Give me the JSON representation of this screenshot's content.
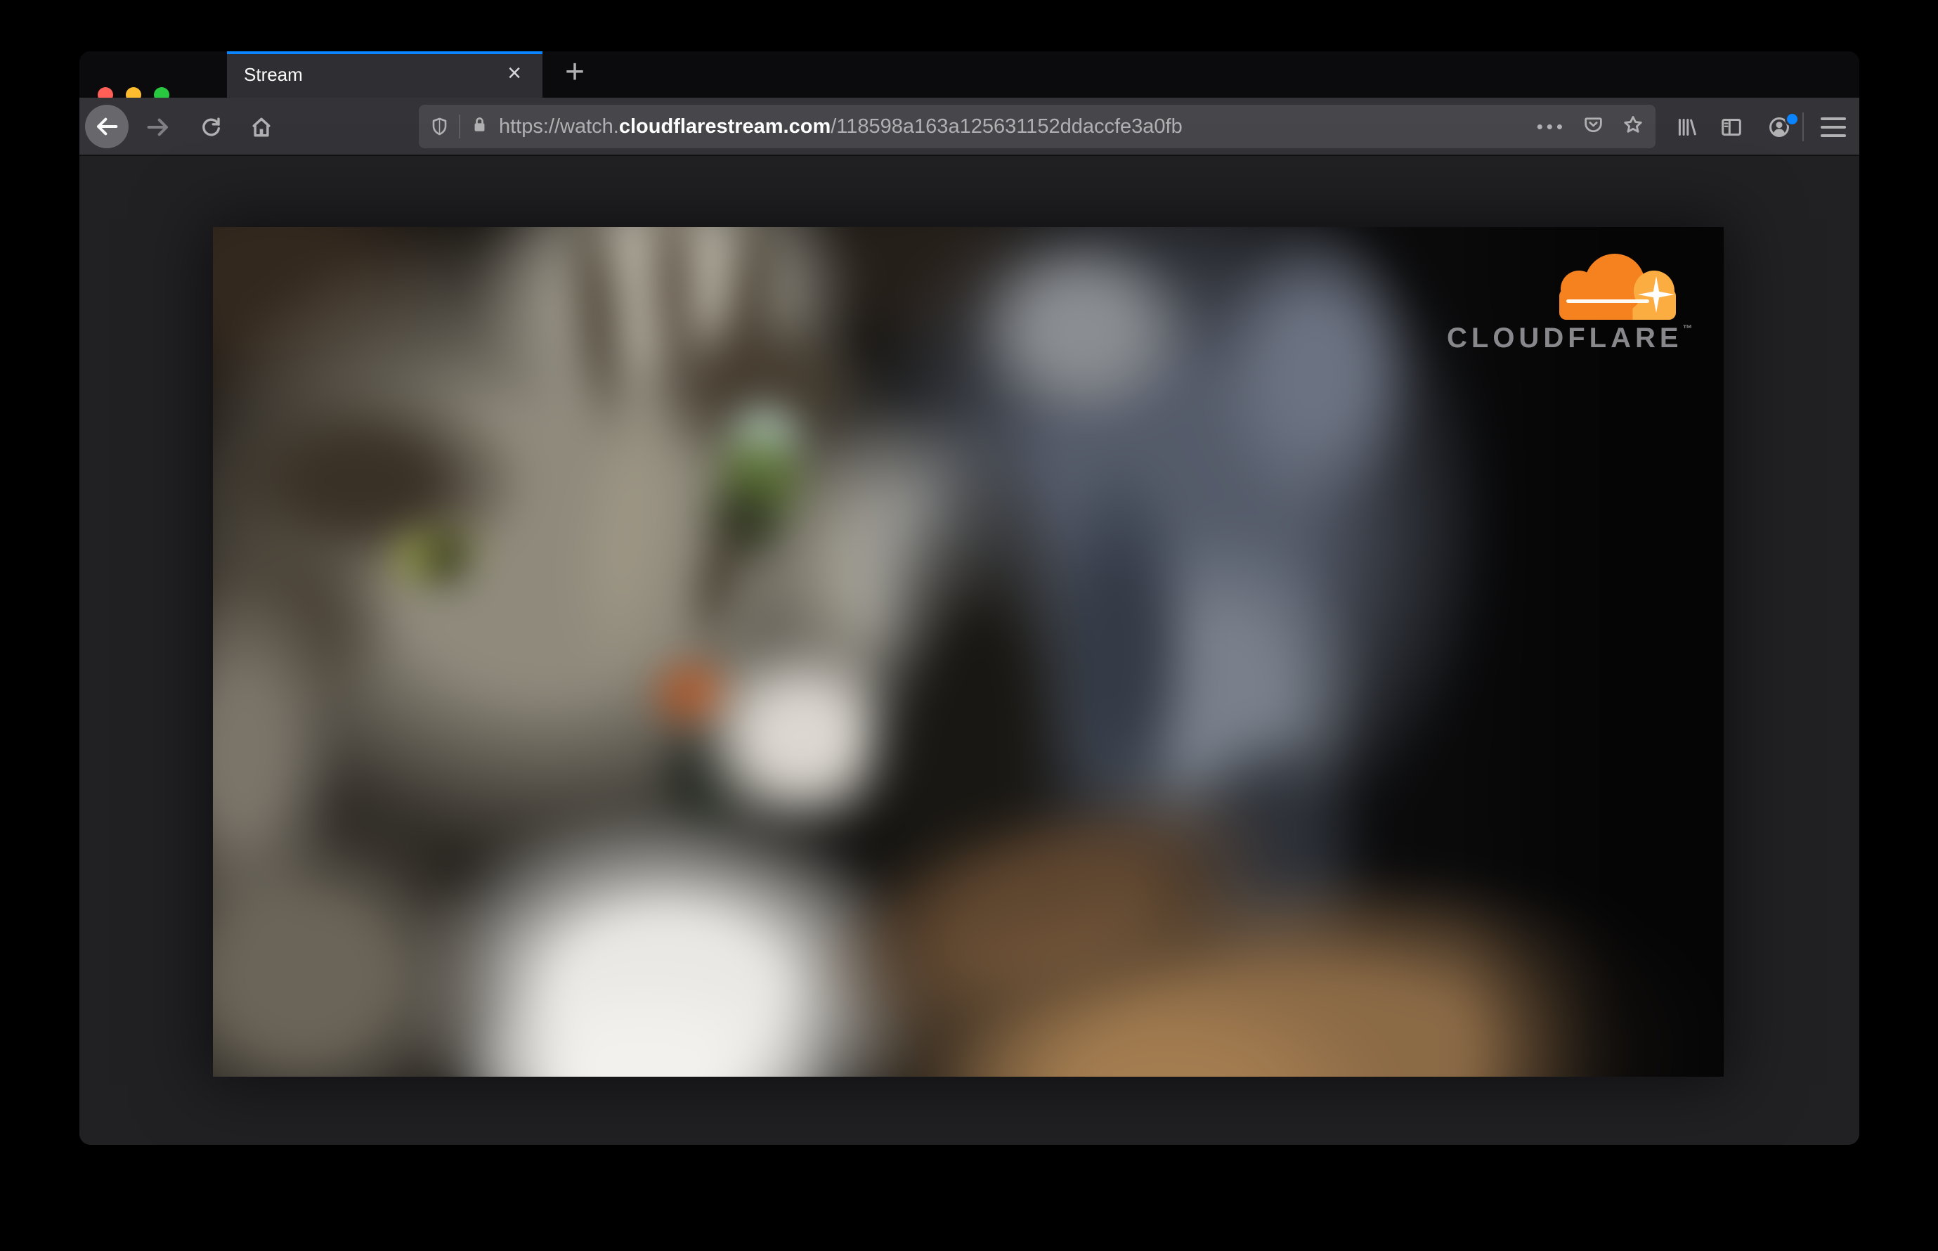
{
  "browser": {
    "tab": {
      "title": "Stream",
      "close_glyph": "×"
    },
    "new_tab_glyph": "+",
    "address_bar": {
      "url_prefix": "https://watch.",
      "url_domain": "cloudflarestream.com",
      "url_path": "/118598a163a125631152ddaccfe3a0fb",
      "page_actions_glyph": "•••"
    }
  },
  "page": {
    "brand": {
      "wordmark": "CLOUDFLARE",
      "trademark": "™"
    }
  },
  "colors": {
    "accent_blue": "#0a84ff",
    "traffic_red": "#ff5f57",
    "traffic_yellow": "#febc2e",
    "traffic_green": "#28c840",
    "toolbar": "#333338",
    "urlbar": "#47474b",
    "tabbar": "#0b0b0d",
    "page_background": "#212124",
    "cloudflare_orange": "#f6821f",
    "cloudflare_orange_light": "#fbad41",
    "logo_text_gray": "#87878c"
  }
}
